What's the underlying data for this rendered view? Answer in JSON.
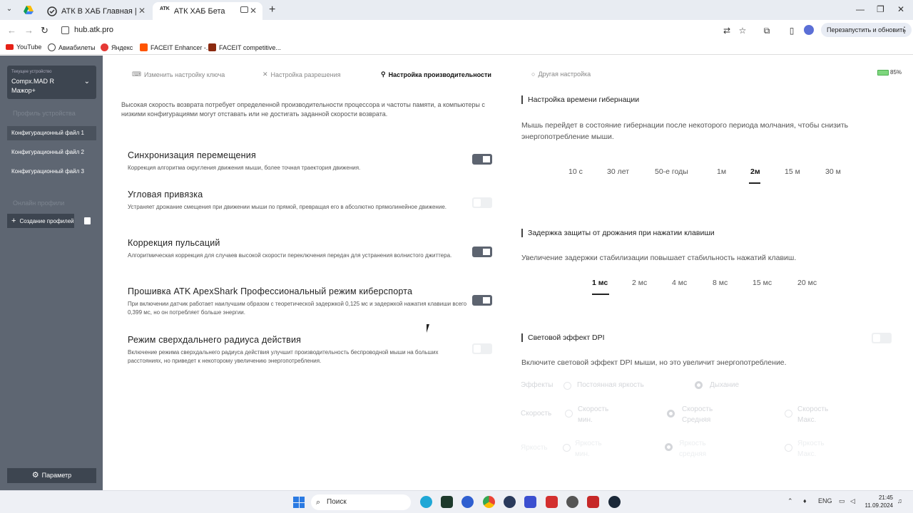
{
  "browser": {
    "tabs": [
      {
        "title": "АТК В ХАБ Главная |",
        "active": false
      },
      {
        "title": "АТК ХАБ Бета",
        "active": true
      }
    ],
    "url": "hub.atk.pro",
    "relaunch_label": "Перезапустить и обновить",
    "bookmarks": [
      {
        "label": "YouTube",
        "icon": "youtube-icon",
        "color": "#e62117"
      },
      {
        "label": "Авиабилеты",
        "icon": "plane-icon",
        "color": "#444444"
      },
      {
        "label": "Яндекс",
        "icon": "yandex-icon",
        "color": "#e53935"
      },
      {
        "label": "FACEIT Enhancer -...",
        "icon": "faceit-icon",
        "color": "#ff5500"
      },
      {
        "label": "FACEIT competitive...",
        "icon": "faceit-icon",
        "color": "#8b2a10"
      }
    ]
  },
  "sidebar": {
    "device_caption": "Текущее устройство",
    "device_name": "Compx.MAD R Мажор+",
    "profiles_heading": "Профиль устройства",
    "config_items": [
      "Конфигурационный файл 1",
      "Конфигурационный файл 2",
      "Конфигурационный файл 3"
    ],
    "online_heading": "Онлайн профили",
    "create_label": "Создание профилей",
    "param_label": "Параметр"
  },
  "tabs": [
    {
      "label": "Изменить настройку ключа",
      "active": false
    },
    {
      "label": "Настройка разрешения",
      "active": false
    },
    {
      "label": "Настройка производительности",
      "active": true
    },
    {
      "label": "Другая настройка",
      "active": false
    }
  ],
  "battery": "85%",
  "intro": "Высокая скорость возврата потребует определенной производительности процессора и частоты памяти, а компьютеры с низкими конфигурациями могут отставать или не достигать заданной скорости возврата.",
  "settings": [
    {
      "title": "Синхронизация перемещения",
      "desc": "Коррекция алгоритма округления движения мыши, более точная траектория движения.",
      "on": true
    },
    {
      "title": "Угловая привязка",
      "desc": "Устраняет дрожание смещения при движении мыши по прямой, превращая его в абсолютно прямолинейное движение.",
      "on": false
    },
    {
      "title": "Коррекция пульсаций",
      "desc": "Алгоритмическая коррекция для случаев высокой скорости переключения передач для устранения волнистого джиттера.",
      "on": true
    },
    {
      "title": "Прошивка ATK ApexShark Профессиональный режим киберспорта",
      "desc": "При включении датчик работает наилучшим образом с теоретической задержкой 0,125 мс и задержкой нажатия клавиши всего 0,399 мс, но он потребляет больше энергии.",
      "on": true
    },
    {
      "title": "Режим сверхдальнего радиуса действия",
      "desc": "Включение режима сверхдальнего радиуса действия улучшит производительность беспроводной мыши на больших расстояниях, но приведет к некоторому увеличению энергопотребления.",
      "on": false
    }
  ],
  "hibernation": {
    "heading": "Настройка времени гибернации",
    "text": "Мышь перейдет в состояние гибернации после некоторого периода молчания, чтобы снизить энергопотребление мыши.",
    "options": [
      "10 с",
      "30 лет",
      "50-е годы",
      "1м",
      "2м",
      "15 м",
      "30 м"
    ],
    "selected": "2м"
  },
  "debounce": {
    "heading": "Задержка защиты от дрожания при нажатии клавиши",
    "text": "Увеличение задержки стабилизации повышает стабильность нажатий клавиш.",
    "options": [
      "1 мс",
      "2 мс",
      "4 мс",
      "8 мс",
      "15 мс",
      "20 мс"
    ],
    "selected": "1 мс"
  },
  "dpi_light": {
    "heading": "Световой эффект DPI",
    "text": "Включите световой эффект DPI мыши, но это увеличит энергопотребление.",
    "on": false,
    "effects_label": "Эффекты",
    "effects": [
      "Постоянная яркость",
      "Дыхание"
    ],
    "speed_label": "Скорость",
    "speeds": [
      "Скорость мин.",
      "Скорость Средняя",
      "Скорость Макс."
    ],
    "brightness_label": "Яркость",
    "brightness": [
      "Яркость мин.",
      "Яркость средняя",
      "Яркость Макс."
    ]
  },
  "taskbar": {
    "search_label": "Поиск",
    "lang": "ENG",
    "time": "21:45",
    "date": "11.09.2024"
  }
}
